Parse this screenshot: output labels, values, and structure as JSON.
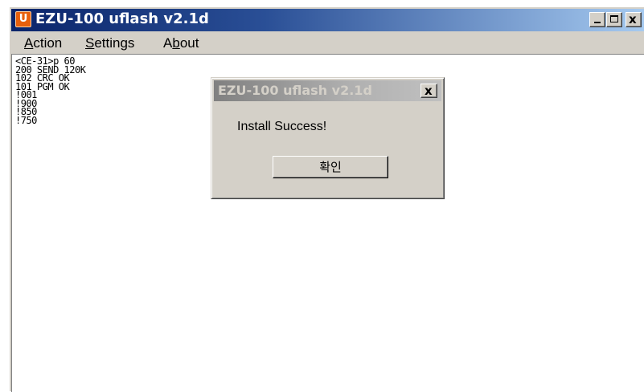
{
  "window": {
    "title": "EZU-100 uflash v2.1d",
    "app_icon_letter": "U",
    "icon_color": "#e8600c",
    "titlebar_color": "#0a246a",
    "controls": {
      "minimize_icon": "minimize-icon",
      "maximize_icon": "maximize-icon",
      "close_icon": "close-icon",
      "close_glyph": "x"
    }
  },
  "menu": {
    "items": [
      {
        "label": "Action",
        "accel": "A"
      },
      {
        "label": "Settings",
        "accel": "S"
      },
      {
        "label": "About",
        "accel": "b"
      }
    ]
  },
  "log": {
    "lines": [
      "<CE-31>p 60",
      "200 SEND 120K",
      "102 CRC OK",
      "101 PGM OK",
      "!001",
      "!900",
      "!850",
      "!750"
    ]
  },
  "dialog": {
    "title": "EZU-100 uflash v2.1d",
    "close_glyph": "x",
    "message": "Install Success!",
    "ok_label": "확인"
  }
}
